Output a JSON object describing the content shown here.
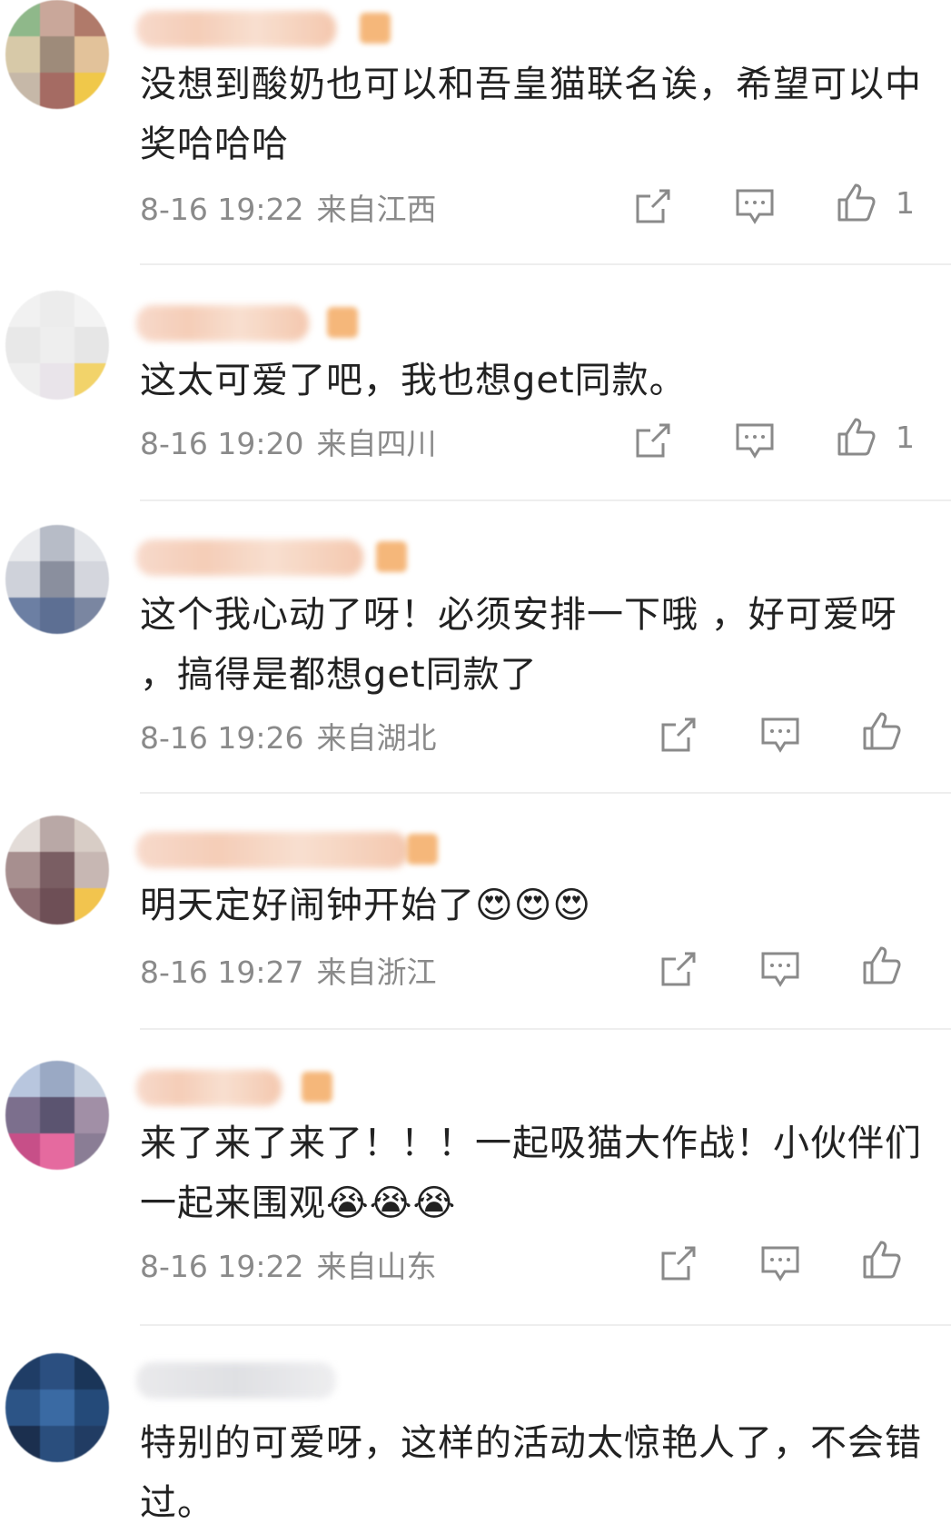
{
  "comments": [
    {
      "text": "没想到酸奶也可以和吾皇猫联名诶，希望可以中奖哈哈哈",
      "date": "8-16 19:22",
      "location": "来自江西",
      "likes": "1",
      "avatar_colors": [
        "#8fb88a",
        "#c9a79a",
        "#b07a6a",
        "#d7c9a8",
        "#9e8b7a",
        "#e2c29a",
        "#c6b8a8",
        "#a56b63",
        "#f0c84a"
      ]
    },
    {
      "text": "这太可爱了吧，我也想get同款。",
      "date": "8-16 19:20",
      "location": "来自四川",
      "likes": "1",
      "avatar_colors": [
        "#f1f1f1",
        "#ececec",
        "#f3f3f3",
        "#e8e8e8",
        "#eeeeee",
        "#e6e6e6",
        "#efefef",
        "#e9e4ea",
        "#f2d36a"
      ]
    },
    {
      "text": "这个我心动了呀！必须安排一下哦 ，好可爱呀 ，搞得是都想get同款了",
      "date": "8-16 19:26",
      "location": "来自湖北",
      "likes": "",
      "avatar_colors": [
        "#e9eaed",
        "#b7bcc7",
        "#e4e6ea",
        "#cfd2da",
        "#8a8f9e",
        "#d4d6dd",
        "#6c7fa3",
        "#5d6f93",
        "#7a86a1"
      ]
    },
    {
      "text": "明天定好闹钟开始了😍😍😍",
      "date": "8-16 19:27",
      "location": "来自浙江",
      "likes": "",
      "avatar_colors": [
        "#e3dcd8",
        "#b9a8a6",
        "#d8cdc6",
        "#a78f8f",
        "#7a5e63",
        "#c7b7b3",
        "#8c6c71",
        "#6e4f56",
        "#f2c44e"
      ]
    },
    {
      "text": "来了来了来了！！！一起吸猫大作战！小伙伴们一起来围观😭😭😭",
      "date": "8-16 19:22",
      "location": "来自山东",
      "likes": "",
      "avatar_colors": [
        "#b8c6de",
        "#9aa9c4",
        "#c7d1e0",
        "#7c6f8d",
        "#5b5470",
        "#a18fa6",
        "#c74f88",
        "#e56a9f",
        "#8a7d95"
      ]
    },
    {
      "text": "特别的可爱呀，这样的活动太惊艳人了，不会错过。",
      "date": "",
      "location": "",
      "likes": "",
      "avatar_colors": [
        "#1f3d66",
        "#2b4f80",
        "#1a3558",
        "#2c5486",
        "#3a6aa3",
        "#244a79",
        "#1b2f4e",
        "#2a4e7d",
        "#213c63"
      ]
    }
  ]
}
